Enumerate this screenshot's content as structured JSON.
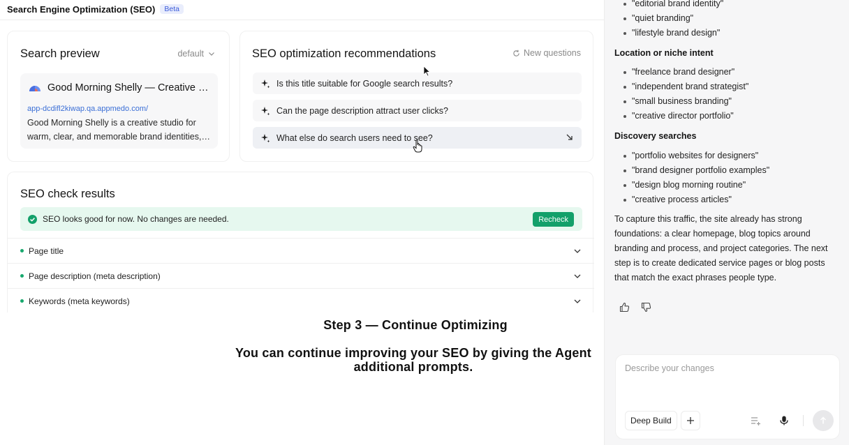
{
  "header": {
    "title": "Search Engine Optimization (SEO)",
    "badge": "Beta"
  },
  "search_preview": {
    "title": "Search preview",
    "mode": "default",
    "site_name": "Good Morning Shelly — Creative Studio",
    "url": "app-dcdifl2kiwap.qa.appmedo.com/",
    "description": "Good Morning Shelly is a creative studio for warm, clear, and memorable brand identities, editorial design, and lifestyle brand design."
  },
  "recommendations": {
    "title": "SEO optimization recommendations",
    "new_questions": "New questions",
    "items": [
      {
        "text": "Is this title suitable for Google search results?"
      },
      {
        "text": "Can the page description attract user clicks?"
      },
      {
        "text": "What else do search users need to see?"
      }
    ]
  },
  "check": {
    "title": "SEO check results",
    "status_text": "SEO looks good for now. No changes are needed.",
    "recheck_label": "Recheck",
    "rows": [
      {
        "label": "Page title"
      },
      {
        "label": "Page description (meta description)"
      },
      {
        "label": "Keywords (meta keywords)"
      }
    ],
    "status_color": "#13a06a"
  },
  "caption": {
    "title": "Step 3 — Continue Optimizing",
    "description": "You can continue improving your SEO by giving the Agent additional prompts."
  },
  "chat": {
    "top_items": [
      "\"editorial brand identity\"",
      "\"quiet branding\"",
      "\"lifestyle brand design\""
    ],
    "location_heading": "Location or niche intent",
    "location_items": [
      "\"freelance brand designer\"",
      "\"independent brand strategist\"",
      "\"small business branding\"",
      "\"creative director portfolio\""
    ],
    "discovery_heading": "Discovery searches",
    "discovery_items": [
      "\"portfolio websites for designers\"",
      "\"brand designer portfolio examples\"",
      "\"design blog morning routine\"",
      "\"creative process articles\""
    ],
    "paragraph": "To capture this traffic, the site already has strong foundations: a clear homepage, blog topics around branding and process, and project categories. The next step is to create dedicated service pages or blog posts that match the exact phrases people type.",
    "composer": {
      "placeholder": "Describe your changes",
      "deep_build_label": "Deep Build"
    }
  }
}
